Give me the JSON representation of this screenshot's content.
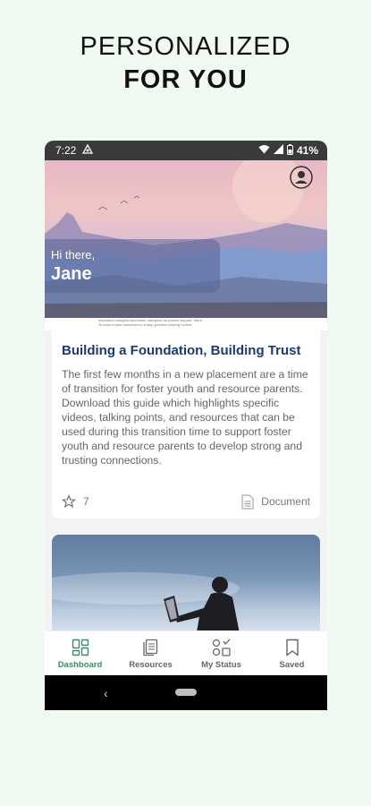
{
  "promo": {
    "line1": "PERSONALIZED",
    "line2": "FOR YOU"
  },
  "status_bar": {
    "time": "7:22",
    "battery": "41%"
  },
  "greeting": {
    "hi": "Hi there,",
    "name": "Jane"
  },
  "doc_preview": {
    "line1": "education caregiver and foster caregiver as a team support. More.",
    "line2": "To learn a fund resources to a stop problem-solving routine"
  },
  "card": {
    "title": "Building a Foundation, Building Trust",
    "description": "The first few months in a new placement are a time of transition for foster youth and resource parents. Download this guide which highlights specific videos, talking points, and resources that can be used during this transition time to support foster youth and resource parents to develop strong and trusting connections.",
    "favorites_count": "7",
    "type_label": "Document"
  },
  "nav": {
    "items": [
      {
        "label": "Dashboard"
      },
      {
        "label": "Resources"
      },
      {
        "label": "My Status"
      },
      {
        "label": "Saved"
      }
    ]
  },
  "colors": {
    "accent_green": "#3e8a64",
    "title_blue": "#1d3a6e",
    "background": "#f0faf0"
  }
}
